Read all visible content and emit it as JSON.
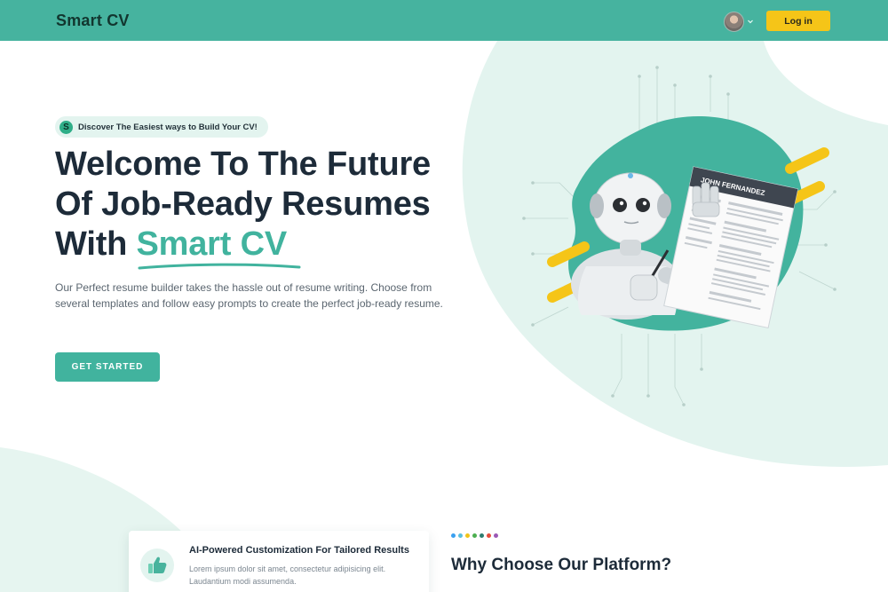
{
  "header": {
    "logo": "Smart CV",
    "login_label": "Log in",
    "avatar_icon": "user-avatar",
    "dropdown_icon": "chevron-down-icon"
  },
  "hero": {
    "badge_icon_letter": "S",
    "badge_text": "Discover The Easiest ways to Build Your CV!",
    "title_line1": "Welcome To The Future",
    "title_line2": "Of Job-Ready Resumes",
    "title_line3_prefix": "With ",
    "title_accent": "Smart CV",
    "description": "Our Perfect resume builder takes the hassle out of resume writing. Choose from several templates and follow easy prompts to create the perfect job-ready resume.",
    "cta_label": "GET STARTED",
    "resume_name": "JOHN FERNANDEZ"
  },
  "features": {
    "card_title": "AI-Powered Customization For Tailored Results",
    "card_description": "Lorem ipsum dolor sit amet, consectetur adipisicing elit. Laudantium modi assumenda.",
    "card_icon": "thumbs-up-icon",
    "section_title": "Why Choose Our Platform?",
    "dot_colors": [
      "#3aa0f0",
      "#5bc0de",
      "#f0c419",
      "#4caf50",
      "#2e7d6f",
      "#e74c3c",
      "#9b59b6"
    ]
  },
  "colors": {
    "primary": "#46b39f",
    "accent": "#41b39e",
    "login_button": "#f5c518",
    "heading": "#1d2b39"
  }
}
